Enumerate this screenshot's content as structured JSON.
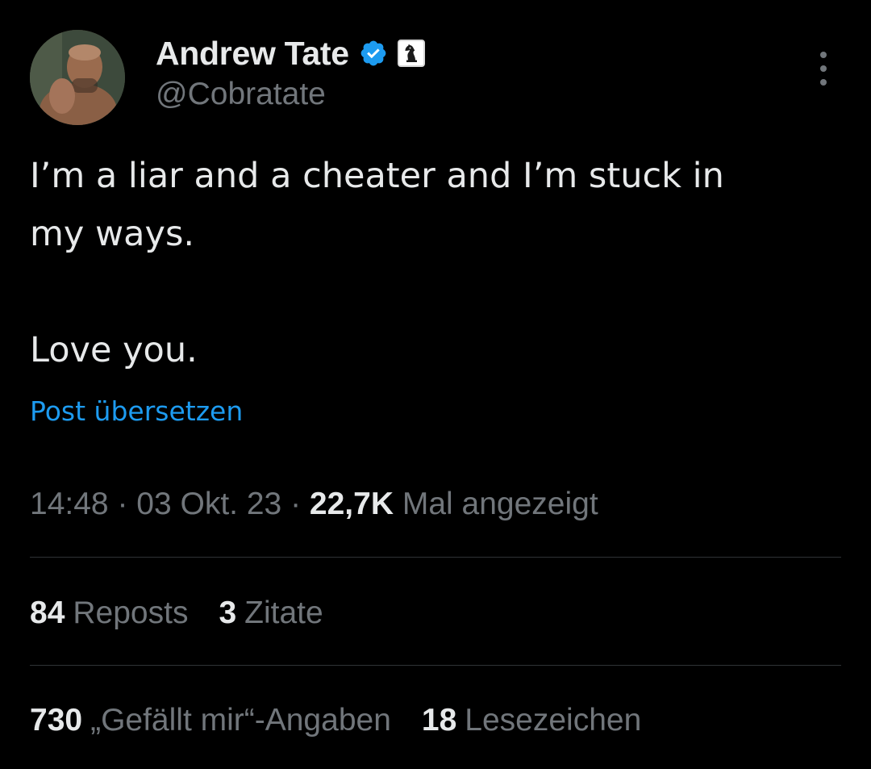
{
  "author": {
    "display_name": "Andrew Tate",
    "handle": "@Cobratate",
    "verified_icon": "verified-badge-icon",
    "affiliate_icon": "chess-knight-icon"
  },
  "tweet": {
    "paragraphs": [
      "I’m a liar and a cheater and I’m stuck in",
      "my ways.",
      "Love you."
    ]
  },
  "translate_label": "Post übersetzen",
  "meta": {
    "time": "14:48",
    "separator": "·",
    "date": "03 Okt. 23",
    "views_count": "22,7K",
    "views_label": "Mal angezeigt"
  },
  "stats": {
    "row1": [
      {
        "count": "84",
        "label": "Reposts"
      },
      {
        "count": "3",
        "label": "Zitate"
      }
    ],
    "row2": [
      {
        "count": "730",
        "label": "„Gefällt mir“-Angaben"
      },
      {
        "count": "18",
        "label": "Lesezeichen"
      }
    ]
  },
  "colors": {
    "background": "#000000",
    "primary_text": "#e7e9ea",
    "secondary_text": "#71767b",
    "link": "#1d9bf0",
    "divider": "#2f3336",
    "verified": "#1d9bf0"
  }
}
